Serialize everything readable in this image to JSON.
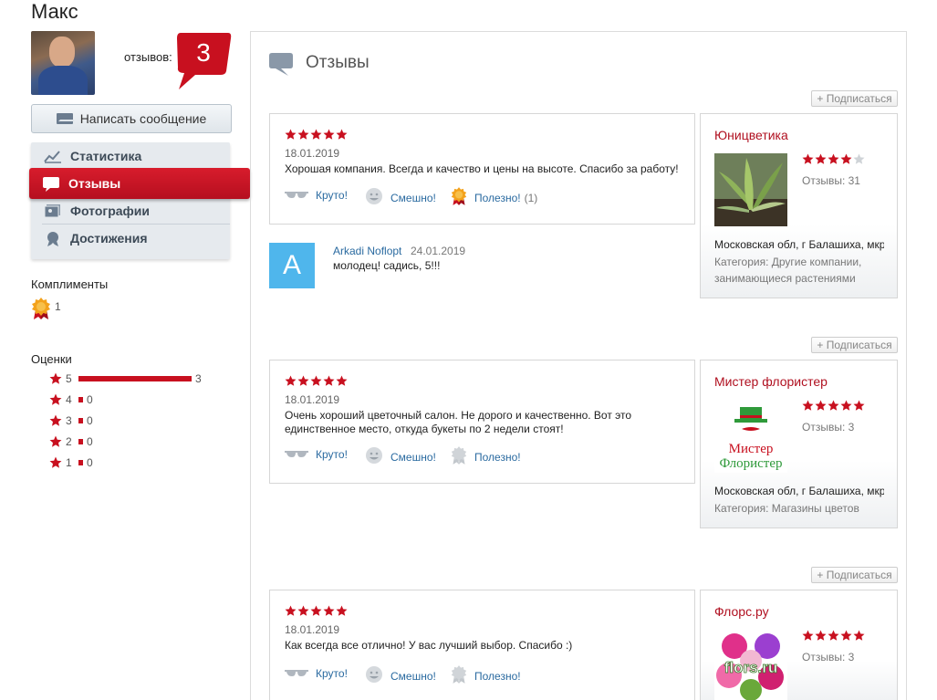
{
  "user": {
    "name": "Макс",
    "reviews_label": "отзывов:",
    "reviews_count": "3"
  },
  "write_message_label": "Написать сообщение",
  "nav": {
    "items": [
      {
        "label": "Статистика",
        "icon": "chart-icon",
        "active": false
      },
      {
        "label": "Отзывы",
        "icon": "review-bubble-icon",
        "active": true
      },
      {
        "label": "Фотографии",
        "icon": "photo-icon",
        "active": false
      },
      {
        "label": "Достижения",
        "icon": "achievement-icon",
        "active": false
      }
    ]
  },
  "compliments": {
    "title": "Комплименты",
    "count": "1"
  },
  "ratings": {
    "title": "Оценки",
    "rows": [
      {
        "stars": "5",
        "count": "3",
        "share": 1.0
      },
      {
        "stars": "4",
        "count": "0",
        "share": 0
      },
      {
        "stars": "3",
        "count": "0",
        "share": 0
      },
      {
        "stars": "2",
        "count": "0",
        "share": 0
      },
      {
        "stars": "1",
        "count": "0",
        "share": 0
      }
    ]
  },
  "panel": {
    "title": "Отзывы",
    "subscribe_label": "+ Подписаться"
  },
  "reviews": [
    {
      "rating": 5,
      "date": "18.01.2019",
      "text": "Хорошая компания. Всегда и качество и цены на высоте. Спасибо за работу!",
      "reactions": {
        "cool": "Круто!",
        "funny": "Смешно!",
        "useful": "Полезно!",
        "useful_count": "(1)"
      },
      "business": {
        "name": "Юницветика",
        "rating": 4,
        "reviews": "Отзывы: 31",
        "address": "Московская обл, г Балашиха, мкр",
        "category": "Категория: Другие компании, занимающиеся растениями"
      },
      "comment": {
        "initial": "A",
        "author": "Arkadi Noflopt",
        "date": "24.01.2019",
        "text": "молодец! садись, 5!!!"
      }
    },
    {
      "rating": 5,
      "date": "18.01.2019",
      "text": "Очень хороший цветочный салон. Не дорого и качественно. Вот это единственное место, откуда букеты по 2 недели стоят!",
      "reactions": {
        "cool": "Круто!",
        "funny": "Смешно!",
        "useful": "Полезно!"
      },
      "business": {
        "name": "Мистер флористер",
        "rating": 5,
        "reviews": "Отзывы: 3",
        "address": "Московская обл, г Балашиха, мкр",
        "category": "Категория: Магазины цветов",
        "logo_text_1": "Мистер",
        "logo_text_2": "Флористер"
      }
    },
    {
      "rating": 5,
      "date": "18.01.2019",
      "text": "Как всегда все отлично! У вас лучший выбор. Спасибо :)",
      "reactions": {
        "cool": "Круто!",
        "funny": "Смешно!",
        "useful": "Полезно!"
      },
      "business": {
        "name": "Флорс.ру",
        "rating": 5,
        "reviews": "Отзывы: 3",
        "logo_text": "flors.ru"
      }
    }
  ],
  "colors": {
    "accent": "#c8101f",
    "link": "#2a6aa0",
    "avatar_bg": "#4fb6ec"
  }
}
